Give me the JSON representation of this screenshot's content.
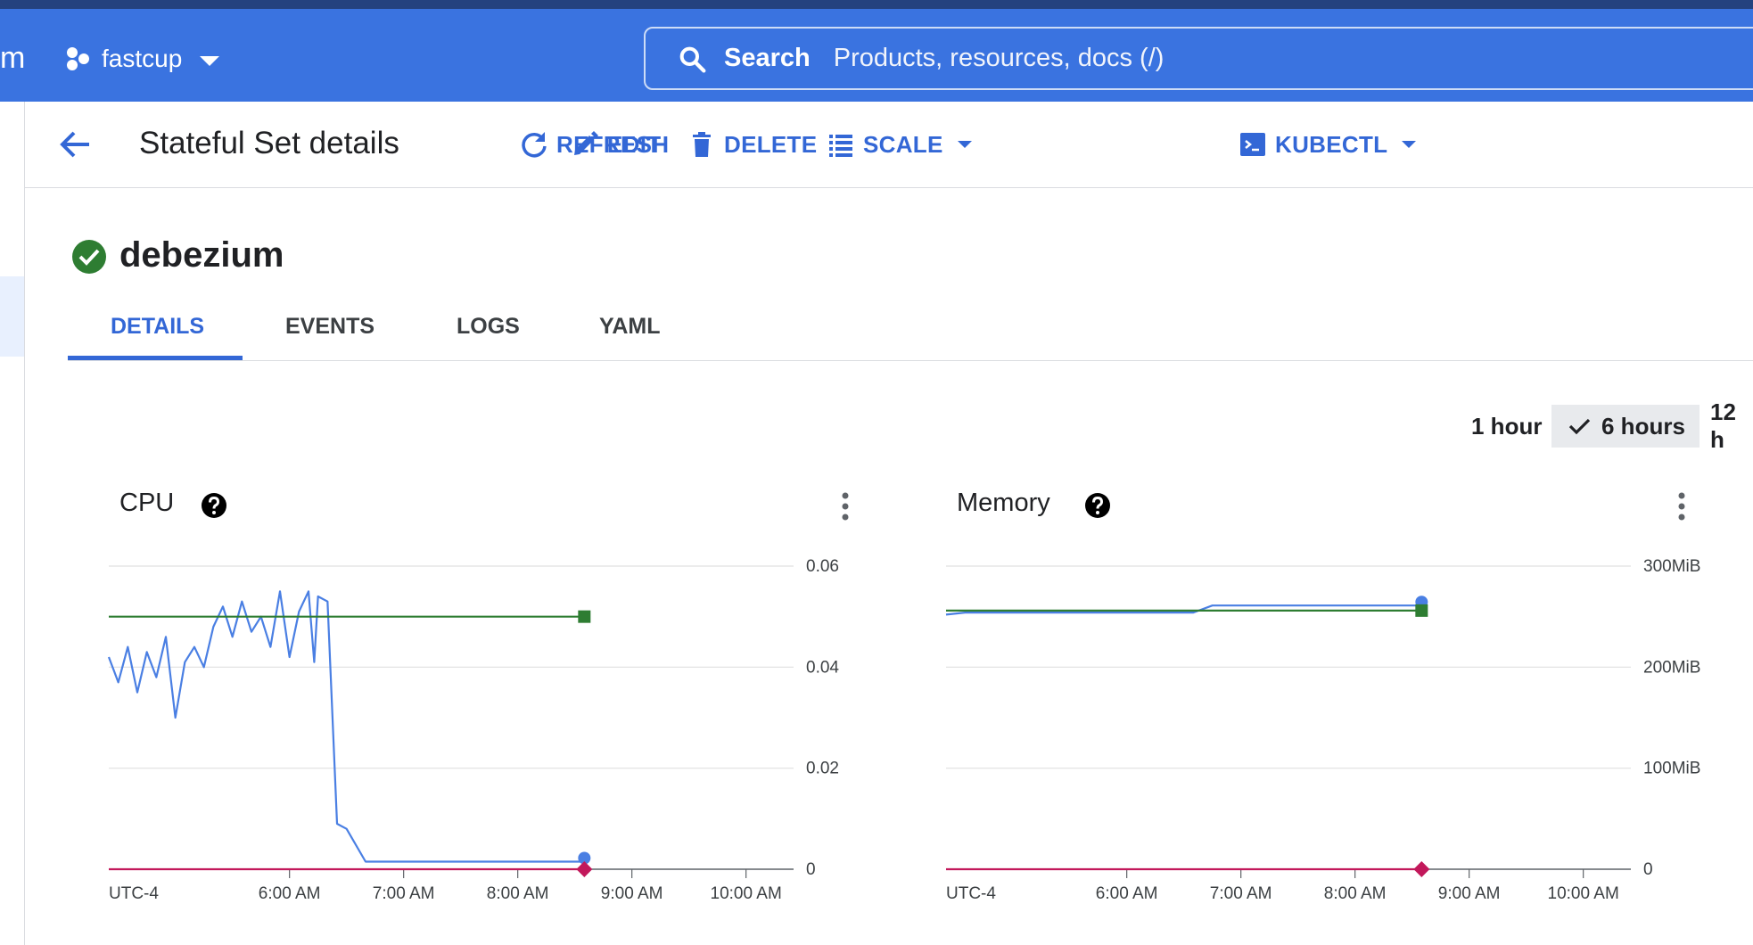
{
  "header": {
    "brand_fragment": "m",
    "project": "fastcup",
    "search_label": "Search",
    "search_placeholder": "Products, resources, docs (/)"
  },
  "toolbar": {
    "title": "Stateful Set details",
    "refresh": "REFRESH",
    "edit": "EDIT",
    "delete": "DELETE",
    "scale": "SCALE",
    "kubectl": "KUBECTL"
  },
  "resource": {
    "name": "debezium",
    "status": "ok"
  },
  "tabs": [
    {
      "label": "DETAILS",
      "active": true
    },
    {
      "label": "EVENTS",
      "active": false
    },
    {
      "label": "LOGS",
      "active": false
    },
    {
      "label": "YAML",
      "active": false
    }
  ],
  "time_range": {
    "options": [
      "1 hour",
      "6 hours",
      "12 h"
    ],
    "selected": "6 hours"
  },
  "colors": {
    "accent": "#3367d6",
    "header": "#3a73e0",
    "usage": "#4a7fe3",
    "request": "#2e7d32",
    "limit": "#c2185b"
  },
  "chart_data": [
    {
      "type": "line",
      "title": "CPU",
      "timezone": "UTC-4",
      "x_ticks": [
        "6:00 AM",
        "7:00 AM",
        "8:00 AM",
        "9:00 AM",
        "10:00 AM"
      ],
      "y_ticks": [
        "0.06",
        "0.04",
        "0.02",
        "0"
      ],
      "ylim": [
        0,
        0.06
      ],
      "xlim": [
        "4:25 AM",
        "10:25 AM"
      ],
      "series": [
        {
          "name": "usage",
          "x": [
            "4:25 AM",
            "4:30 AM",
            "4:35 AM",
            "4:40 AM",
            "4:45 AM",
            "4:50 AM",
            "4:55 AM",
            "5:00 AM",
            "5:05 AM",
            "5:10 AM",
            "5:15 AM",
            "5:20 AM",
            "5:25 AM",
            "5:30 AM",
            "5:35 AM",
            "5:40 AM",
            "5:45 AM",
            "5:50 AM",
            "5:55 AM",
            "6:00 AM",
            "6:05 AM",
            "6:10 AM",
            "6:13 AM",
            "6:15 AM",
            "6:20 AM",
            "6:25 AM",
            "6:30 AM",
            "6:40 AM",
            "7:00 AM",
            "7:30 AM",
            "8:00 AM",
            "8:20 AM",
            "8:35 AM"
          ],
          "values": [
            0.042,
            0.037,
            0.044,
            0.035,
            0.043,
            0.038,
            0.046,
            0.03,
            0.041,
            0.044,
            0.04,
            0.048,
            0.052,
            0.046,
            0.053,
            0.047,
            0.05,
            0.044,
            0.055,
            0.042,
            0.051,
            0.055,
            0.041,
            0.054,
            0.053,
            0.009,
            0.008,
            0.0015,
            0.0015,
            0.0015,
            0.0015,
            0.0015,
            0.0015
          ]
        },
        {
          "name": "request",
          "x": [
            "4:25 AM",
            "8:35 AM"
          ],
          "values": [
            0.05,
            0.05
          ]
        },
        {
          "name": "limit",
          "x": [
            "4:25 AM",
            "8:35 AM"
          ],
          "values": [
            0,
            0
          ]
        }
      ]
    },
    {
      "type": "line",
      "title": "Memory",
      "timezone": "UTC-4",
      "x_ticks": [
        "6:00 AM",
        "7:00 AM",
        "8:00 AM",
        "9:00 AM",
        "10:00 AM"
      ],
      "y_ticks": [
        "300MiB",
        "200MiB",
        "100MiB",
        "0"
      ],
      "ylim": [
        0,
        300
      ],
      "xlim": [
        "4:25 AM",
        "10:25 AM"
      ],
      "series": [
        {
          "name": "usage",
          "x": [
            "4:25 AM",
            "4:35 AM",
            "6:35 AM",
            "6:45 AM",
            "8:35 AM"
          ],
          "values": [
            252,
            254,
            254,
            261,
            261
          ]
        },
        {
          "name": "request",
          "x": [
            "4:25 AM",
            "8:35 AM"
          ],
          "values": [
            256,
            256
          ]
        },
        {
          "name": "limit",
          "x": [
            "4:25 AM",
            "8:35 AM"
          ],
          "values": [
            0,
            0
          ]
        }
      ]
    }
  ]
}
